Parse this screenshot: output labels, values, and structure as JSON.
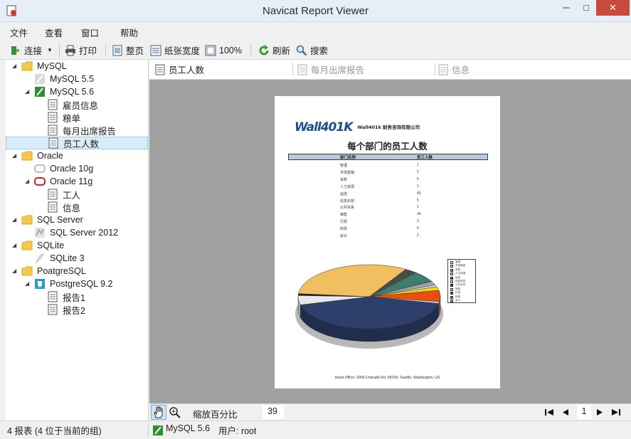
{
  "window": {
    "title": "Navicat Report Viewer",
    "minimize": "─",
    "maximize": "□",
    "close": "✕"
  },
  "menu": [
    "文件",
    "查看",
    "窗口",
    "帮助"
  ],
  "toolbar": {
    "connect": "连接",
    "print": "打印",
    "whole_page": "整页",
    "page_width": "纸张宽度",
    "zoom100": "100%",
    "refresh": "刷新",
    "search": "搜索"
  },
  "tree": [
    {
      "label": "MySQL",
      "icon": "folder-icon"
    },
    {
      "label": "MySQL 5.5",
      "icon": "mysql-connection-closed-icon"
    },
    {
      "label": "MySQL 5.6",
      "icon": "mysql-connection-open-icon"
    },
    {
      "label": "雇员信息",
      "icon": "report-icon"
    },
    {
      "label": "粮单",
      "icon": "report-icon"
    },
    {
      "label": "每月出席报告",
      "icon": "report-icon"
    },
    {
      "label": "员工人数",
      "icon": "report-icon"
    },
    {
      "label": "Oracle",
      "icon": "folder-icon"
    },
    {
      "label": "Oracle 10g",
      "icon": "oracle-connection-closed-icon"
    },
    {
      "label": "Oracle 11g",
      "icon": "oracle-connection-open-icon"
    },
    {
      "label": "工人",
      "icon": "report-icon"
    },
    {
      "label": "信息",
      "icon": "report-icon"
    },
    {
      "label": "SQL Server",
      "icon": "folder-icon"
    },
    {
      "label": "SQL Server 2012",
      "icon": "sqlserver-connection-icon"
    },
    {
      "label": "SQLite",
      "icon": "folder-icon"
    },
    {
      "label": "SQLite 3",
      "icon": "sqlite-connection-icon"
    },
    {
      "label": "PoatgreSQL",
      "icon": "folder-icon"
    },
    {
      "label": "PostgreSQL 9.2",
      "icon": "postgresql-connection-icon"
    },
    {
      "label": "报告1",
      "icon": "report-icon"
    },
    {
      "label": "报告2",
      "icon": "report-icon"
    }
  ],
  "tabs": [
    "员工人数",
    "每月出席报告",
    "信息"
  ],
  "report": {
    "logo_mark": "Wall401K",
    "logo_company": "Wall401k 财务咨询有限公司",
    "title": "每个部门的员工人数",
    "col_dept": "部门名称",
    "col_count": "员工人数",
    "rows": [
      [
        "管理",
        "1"
      ],
      [
        "市场营销",
        "2"
      ],
      [
        "采购",
        "6"
      ],
      [
        "人力资源",
        "1"
      ],
      [
        "运送",
        "45"
      ],
      [
        "信息科技",
        "5"
      ],
      [
        "公共关系",
        "1"
      ],
      [
        "销售",
        "34"
      ],
      [
        "行政",
        "3"
      ],
      [
        "财政",
        "6"
      ],
      [
        "会计",
        "2"
      ]
    ],
    "footer": "Head Office: 2004 Charade Rd, 98199, Seattle, Washington, US"
  },
  "chart_data": {
    "type": "pie",
    "title": "",
    "categories": [
      "管理",
      "市场营销",
      "采购",
      "人力资源",
      "运送",
      "信息科技",
      "公共关系",
      "销售",
      "行政",
      "财政",
      "会计"
    ],
    "values": [
      1,
      2,
      6,
      1,
      45,
      5,
      1,
      34,
      3,
      6,
      2
    ],
    "colors": [
      "#e8e8e8",
      "#f2d60b",
      "#e94e10",
      "#d4d4d4",
      "#2e3f6b",
      "#e8e8e8",
      "#202020",
      "#f0c060",
      "#4b4b4b",
      "#3c7e6d",
      "#a4a4a4"
    ],
    "legend": "right"
  },
  "navbar": {
    "zoom_label": "缩放百分比",
    "zoom_value": "39",
    "page": "1"
  },
  "status": {
    "left": "4 报表 (4 位于当前的组)",
    "connection": "MySQL 5.6",
    "user": "用户: root"
  }
}
